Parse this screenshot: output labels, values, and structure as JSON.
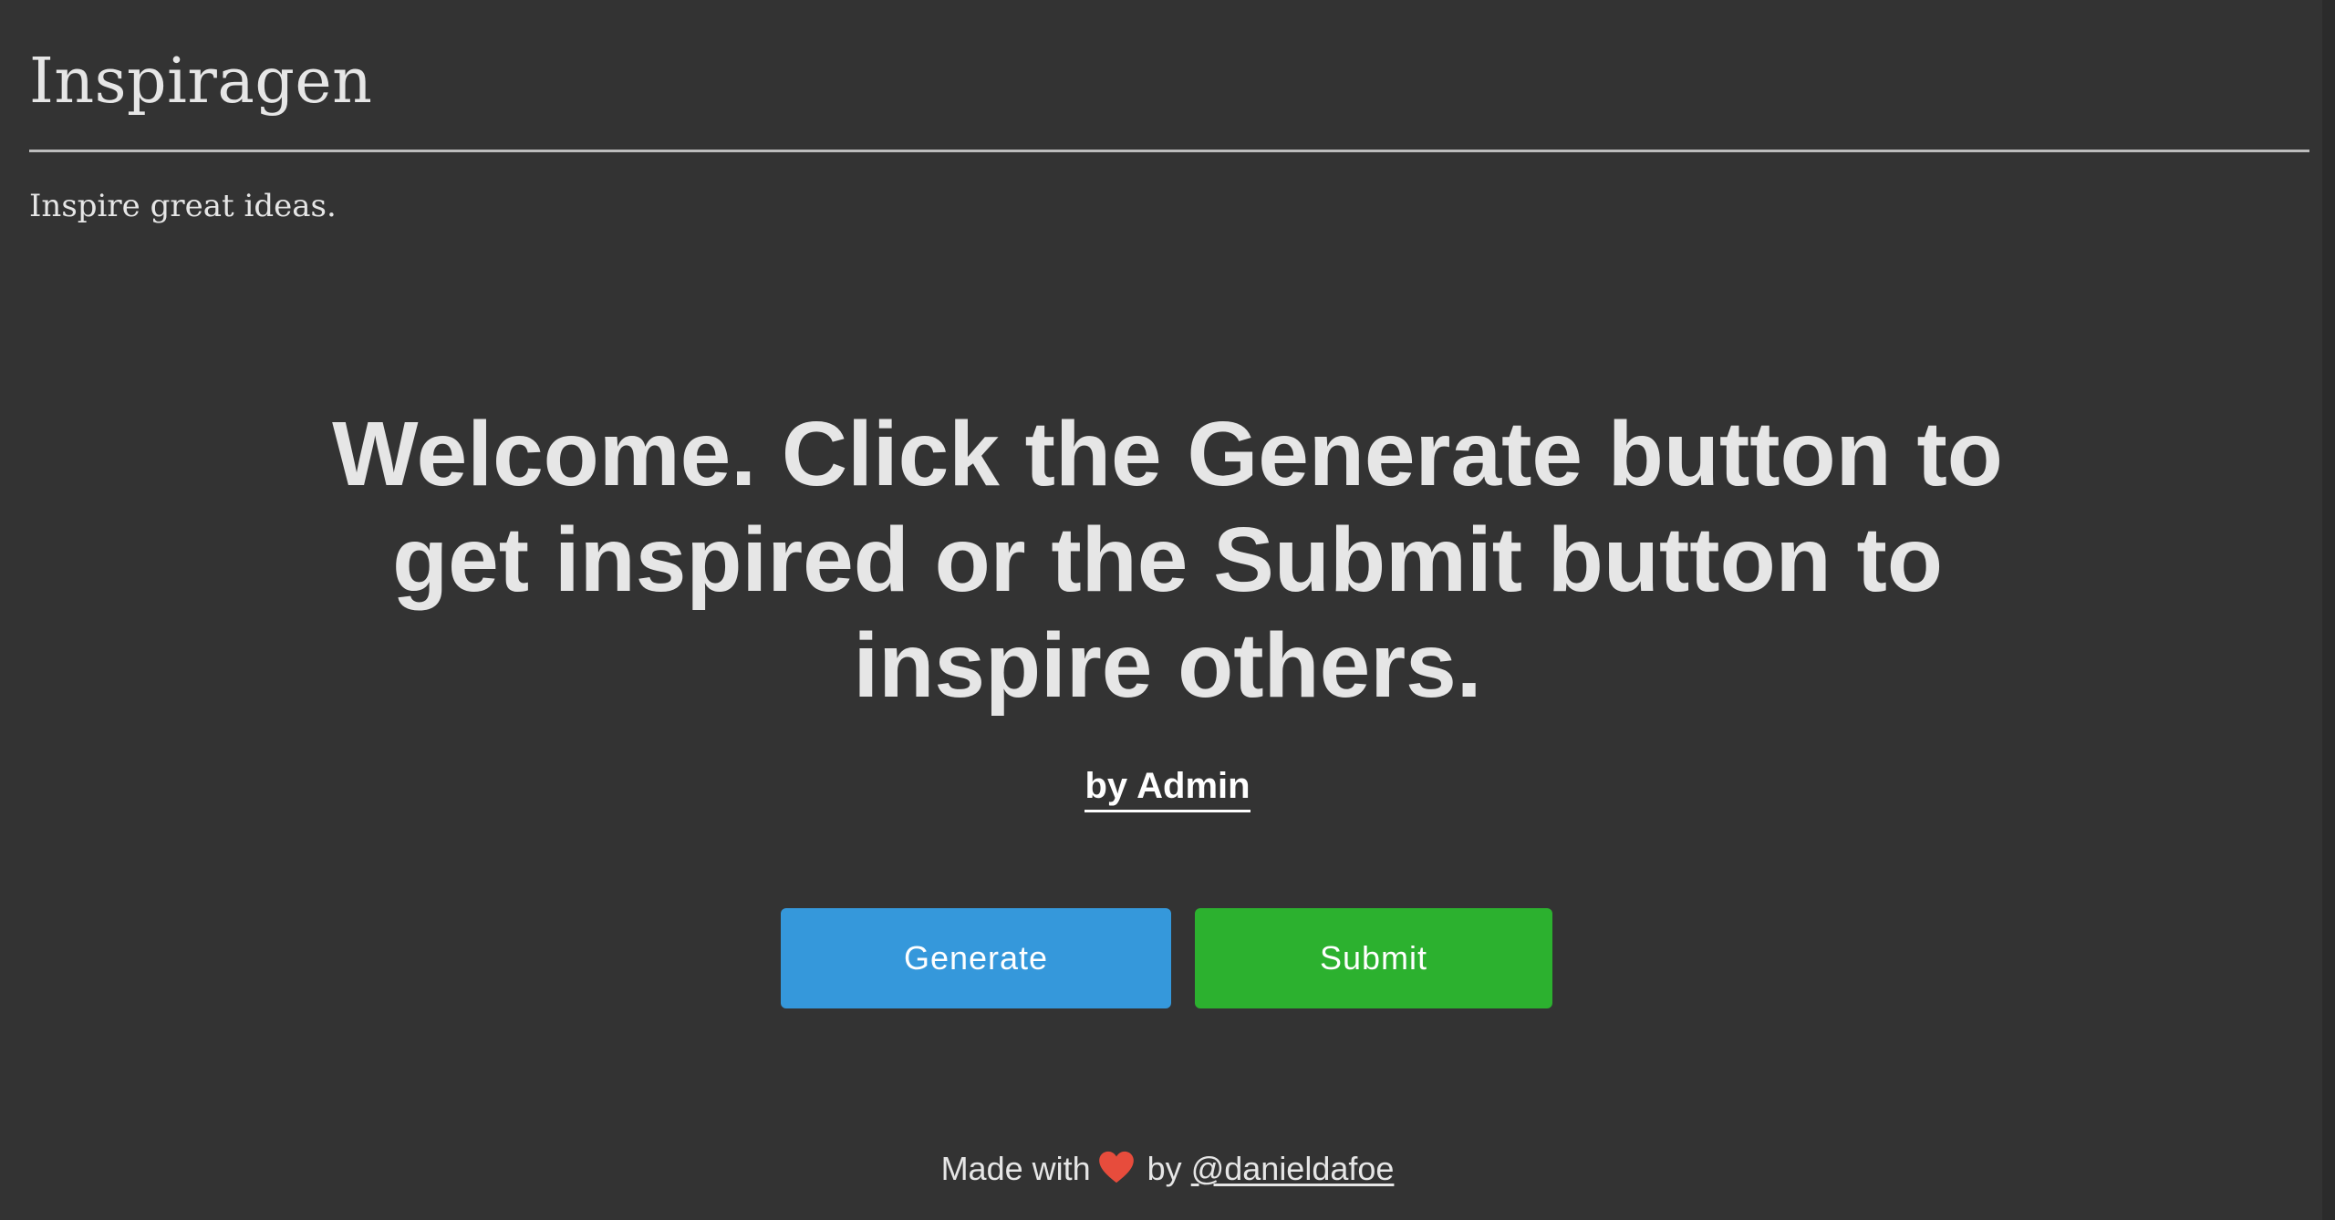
{
  "header": {
    "title": "Inspiragen",
    "tagline": "Inspire great ideas."
  },
  "main": {
    "quote": "Welcome. Click the Generate button to get inspired or the Submit button to inspire others.",
    "author_prefix": "by",
    "author_name": "Admin"
  },
  "actions": {
    "generate_label": "Generate",
    "submit_label": "Submit"
  },
  "footer": {
    "made_with": "Made with",
    "heart_icon": "heart-icon",
    "by": "by",
    "handle": "@danieldafoe"
  },
  "colors": {
    "background": "#333333",
    "generate_button": "#3598db",
    "submit_button": "#2cb12f",
    "heart": "#e74c3c"
  }
}
